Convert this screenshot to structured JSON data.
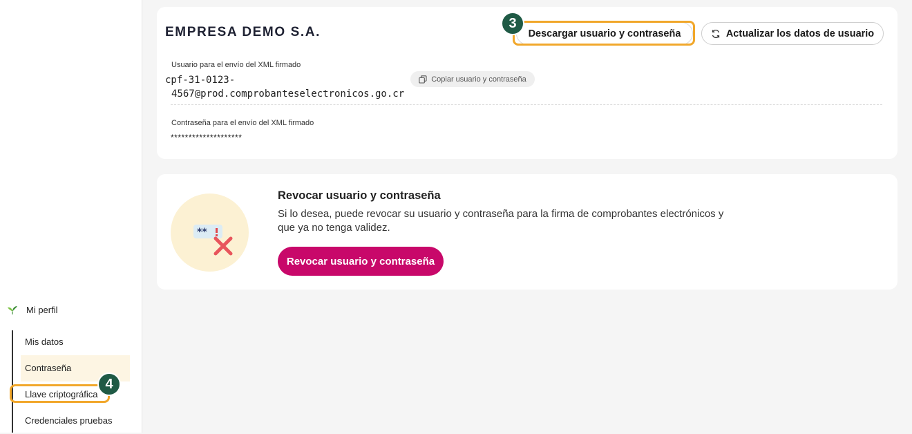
{
  "sidebar": {
    "parent_label": "Mi perfil",
    "items": [
      {
        "label": "Mis datos"
      },
      {
        "label": "Contraseña"
      },
      {
        "label": "Llave criptográfica"
      },
      {
        "label": "Credenciales pruebas"
      }
    ]
  },
  "annotations": {
    "step_3": "3",
    "step_4": "4",
    "highlight_color": "#f1a72b",
    "badge_color": "#1f5a45"
  },
  "credentials": {
    "company_name": "EMPRESA DEMO S.A.",
    "download_button": "Descargar usuario y contraseña",
    "refresh_button": "Actualizar los datos de usuario",
    "user_label": "Usuario para el envío del XML firmado",
    "user_value_line1": "cpf-31-0123-",
    "user_value_line2": "4567@prod.comprobanteselectronicos.go.cr",
    "copy_button": "Copiar usuario y contraseña",
    "password_label": "Contraseña para el envío del XML firmado",
    "password_value": "********************"
  },
  "revoke": {
    "title": "Revocar usuario y contraseña",
    "description": "Si lo desea, puede revocar su usuario y contraseña para la firma de comprobantes electrónicos y que ya no tenga validez.",
    "button": "Revocar usuario y contraseña",
    "accent_color": "#c8086a"
  }
}
